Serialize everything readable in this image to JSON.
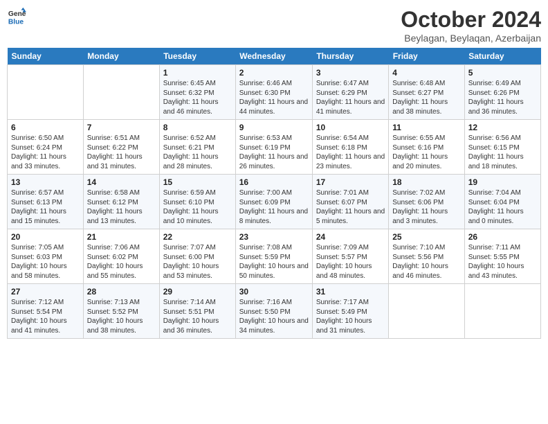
{
  "header": {
    "logo_line1": "General",
    "logo_line2": "Blue",
    "title": "October 2024",
    "subtitle": "Beylagan, Beylaqan, Azerbaijan"
  },
  "days_of_week": [
    "Sunday",
    "Monday",
    "Tuesday",
    "Wednesday",
    "Thursday",
    "Friday",
    "Saturday"
  ],
  "weeks": [
    [
      {
        "day": "",
        "info": ""
      },
      {
        "day": "",
        "info": ""
      },
      {
        "day": "1",
        "info": "Sunrise: 6:45 AM\nSunset: 6:32 PM\nDaylight: 11 hours and 46 minutes."
      },
      {
        "day": "2",
        "info": "Sunrise: 6:46 AM\nSunset: 6:30 PM\nDaylight: 11 hours and 44 minutes."
      },
      {
        "day": "3",
        "info": "Sunrise: 6:47 AM\nSunset: 6:29 PM\nDaylight: 11 hours and 41 minutes."
      },
      {
        "day": "4",
        "info": "Sunrise: 6:48 AM\nSunset: 6:27 PM\nDaylight: 11 hours and 38 minutes."
      },
      {
        "day": "5",
        "info": "Sunrise: 6:49 AM\nSunset: 6:26 PM\nDaylight: 11 hours and 36 minutes."
      }
    ],
    [
      {
        "day": "6",
        "info": "Sunrise: 6:50 AM\nSunset: 6:24 PM\nDaylight: 11 hours and 33 minutes."
      },
      {
        "day": "7",
        "info": "Sunrise: 6:51 AM\nSunset: 6:22 PM\nDaylight: 11 hours and 31 minutes."
      },
      {
        "day": "8",
        "info": "Sunrise: 6:52 AM\nSunset: 6:21 PM\nDaylight: 11 hours and 28 minutes."
      },
      {
        "day": "9",
        "info": "Sunrise: 6:53 AM\nSunset: 6:19 PM\nDaylight: 11 hours and 26 minutes."
      },
      {
        "day": "10",
        "info": "Sunrise: 6:54 AM\nSunset: 6:18 PM\nDaylight: 11 hours and 23 minutes."
      },
      {
        "day": "11",
        "info": "Sunrise: 6:55 AM\nSunset: 6:16 PM\nDaylight: 11 hours and 20 minutes."
      },
      {
        "day": "12",
        "info": "Sunrise: 6:56 AM\nSunset: 6:15 PM\nDaylight: 11 hours and 18 minutes."
      }
    ],
    [
      {
        "day": "13",
        "info": "Sunrise: 6:57 AM\nSunset: 6:13 PM\nDaylight: 11 hours and 15 minutes."
      },
      {
        "day": "14",
        "info": "Sunrise: 6:58 AM\nSunset: 6:12 PM\nDaylight: 11 hours and 13 minutes."
      },
      {
        "day": "15",
        "info": "Sunrise: 6:59 AM\nSunset: 6:10 PM\nDaylight: 11 hours and 10 minutes."
      },
      {
        "day": "16",
        "info": "Sunrise: 7:00 AM\nSunset: 6:09 PM\nDaylight: 11 hours and 8 minutes."
      },
      {
        "day": "17",
        "info": "Sunrise: 7:01 AM\nSunset: 6:07 PM\nDaylight: 11 hours and 5 minutes."
      },
      {
        "day": "18",
        "info": "Sunrise: 7:02 AM\nSunset: 6:06 PM\nDaylight: 11 hours and 3 minutes."
      },
      {
        "day": "19",
        "info": "Sunrise: 7:04 AM\nSunset: 6:04 PM\nDaylight: 11 hours and 0 minutes."
      }
    ],
    [
      {
        "day": "20",
        "info": "Sunrise: 7:05 AM\nSunset: 6:03 PM\nDaylight: 10 hours and 58 minutes."
      },
      {
        "day": "21",
        "info": "Sunrise: 7:06 AM\nSunset: 6:02 PM\nDaylight: 10 hours and 55 minutes."
      },
      {
        "day": "22",
        "info": "Sunrise: 7:07 AM\nSunset: 6:00 PM\nDaylight: 10 hours and 53 minutes."
      },
      {
        "day": "23",
        "info": "Sunrise: 7:08 AM\nSunset: 5:59 PM\nDaylight: 10 hours and 50 minutes."
      },
      {
        "day": "24",
        "info": "Sunrise: 7:09 AM\nSunset: 5:57 PM\nDaylight: 10 hours and 48 minutes."
      },
      {
        "day": "25",
        "info": "Sunrise: 7:10 AM\nSunset: 5:56 PM\nDaylight: 10 hours and 46 minutes."
      },
      {
        "day": "26",
        "info": "Sunrise: 7:11 AM\nSunset: 5:55 PM\nDaylight: 10 hours and 43 minutes."
      }
    ],
    [
      {
        "day": "27",
        "info": "Sunrise: 7:12 AM\nSunset: 5:54 PM\nDaylight: 10 hours and 41 minutes."
      },
      {
        "day": "28",
        "info": "Sunrise: 7:13 AM\nSunset: 5:52 PM\nDaylight: 10 hours and 38 minutes."
      },
      {
        "day": "29",
        "info": "Sunrise: 7:14 AM\nSunset: 5:51 PM\nDaylight: 10 hours and 36 minutes."
      },
      {
        "day": "30",
        "info": "Sunrise: 7:16 AM\nSunset: 5:50 PM\nDaylight: 10 hours and 34 minutes."
      },
      {
        "day": "31",
        "info": "Sunrise: 7:17 AM\nSunset: 5:49 PM\nDaylight: 10 hours and 31 minutes."
      },
      {
        "day": "",
        "info": ""
      },
      {
        "day": "",
        "info": ""
      }
    ]
  ]
}
